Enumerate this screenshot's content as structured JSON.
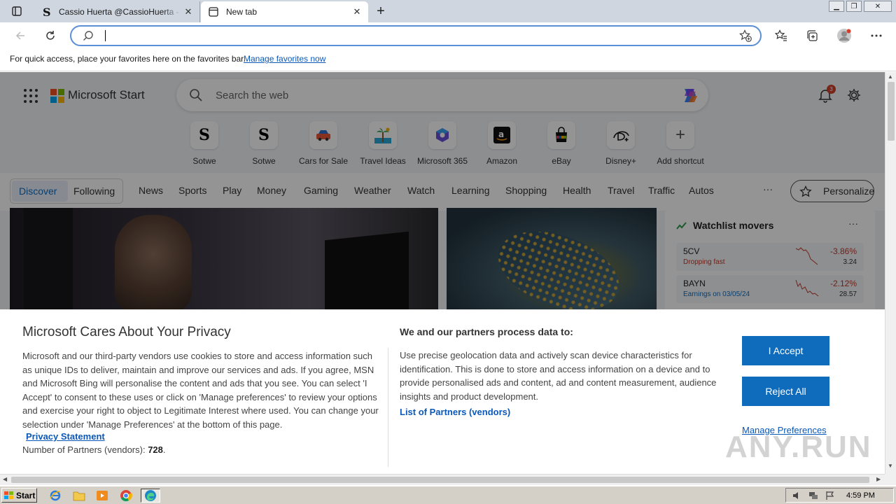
{
  "browser": {
    "tabs": [
      {
        "title": "Cassio Huerta @CassioHuerta - T",
        "active": false
      },
      {
        "title": "New tab",
        "active": true
      }
    ],
    "address": {
      "value": "",
      "placeholder": ""
    },
    "favorites_bar": {
      "message": "For quick access, place your favorites here on the favorites bar.",
      "link": "Manage favorites now"
    }
  },
  "start_page": {
    "brand": "Microsoft Start",
    "search_placeholder": "Search the web",
    "notification_count": "3",
    "shortcuts": [
      {
        "label": "Sotwe",
        "icon": "sotwe-icon"
      },
      {
        "label": "Sotwe",
        "icon": "sotwe-icon"
      },
      {
        "label": "Cars for Sale",
        "icon": "car-icon"
      },
      {
        "label": "Travel Ideas",
        "icon": "palm-tree-icon"
      },
      {
        "label": "Microsoft 365",
        "icon": "m365-icon"
      },
      {
        "label": "Amazon",
        "icon": "amazon-icon"
      },
      {
        "label": "eBay",
        "icon": "ebay-icon"
      },
      {
        "label": "Disney+",
        "icon": "disney-icon"
      },
      {
        "label": "Add shortcut",
        "icon": "plus-icon"
      }
    ],
    "segment": {
      "discover": "Discover",
      "following": "Following"
    },
    "nav": [
      "News",
      "Sports",
      "Play",
      "Money",
      "Gaming",
      "Weather",
      "Watch",
      "Learning",
      "Shopping",
      "Health",
      "Travel",
      "Traffic",
      "Autos"
    ],
    "more": "···",
    "personalize": "Personalize",
    "watchlist": {
      "title": "Watchlist movers",
      "more": "···",
      "items": [
        {
          "symbol": "5CV",
          "sub": "Dropping fast",
          "sub_color": "#c0392b",
          "change": "-3.86%",
          "price": "3.24"
        },
        {
          "symbol": "BAYN",
          "sub": "Earnings on 03/05/24",
          "sub_color": "#0f6cbd",
          "change": "-2.12%",
          "price": "28.57"
        }
      ]
    }
  },
  "privacy": {
    "title": "Microsoft Cares About Your Privacy",
    "body": "Microsoft and our third-party vendors use cookies to store and access information such as unique IDs to deliver, maintain and improve our services and ads. If you agree, MSN and Microsoft Bing will personalise the content and ads that you see. You can select 'I Accept' to consent to these uses or click on 'Manage preferences' to review your options and exercise your right to object to Legitimate Interest where used.  You can change your selection under 'Manage Preferences' at the bottom of this page.",
    "privacy_link": "Privacy Statement",
    "partners_label": "Number of Partners (vendors): ",
    "partners_count": "728",
    "purposes_title": "We and our partners process data to:",
    "purposes_body": "Use precise geolocation data and actively scan device characteristics for identification. This is done to store and access information on a device and to provide personalised ads and content, ad and content measurement, audience insights and product development.",
    "partners_link": "List of Partners (vendors)",
    "accept": "I Accept",
    "reject": "Reject All",
    "manage": "Manage Preferences"
  },
  "watermark": "ANY.RUN",
  "taskbar": {
    "start": "Start",
    "clock": "4:59 PM"
  },
  "colors": {
    "accent": "#0f6cbd",
    "address_border": "#5b8fd6",
    "negative": "#c0392b"
  }
}
